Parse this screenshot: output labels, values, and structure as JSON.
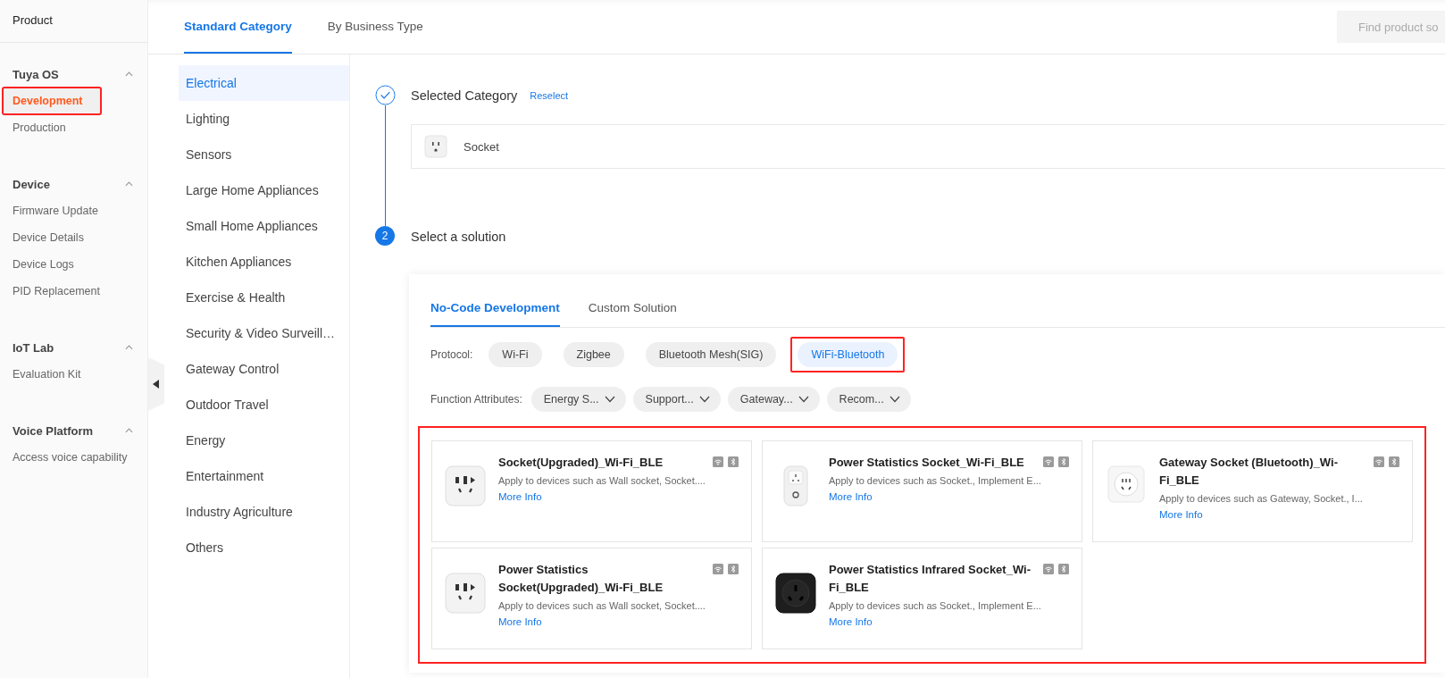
{
  "sidebar": {
    "title": "Product",
    "groups": [
      {
        "label": "Tuya OS",
        "expanded": true,
        "items": [
          {
            "label": "Development",
            "selected": true,
            "highlighted": true
          },
          {
            "label": "Production",
            "selected": false,
            "highlighted": false
          }
        ]
      },
      {
        "label": "Device",
        "expanded": true,
        "items": [
          {
            "label": "Firmware Update",
            "selected": false,
            "highlighted": false
          },
          {
            "label": "Device Details",
            "selected": false,
            "highlighted": false
          },
          {
            "label": "Device Logs",
            "selected": false,
            "highlighted": false
          },
          {
            "label": "PID Replacement",
            "selected": false,
            "highlighted": false
          }
        ]
      },
      {
        "label": "IoT Lab",
        "expanded": true,
        "items": [
          {
            "label": "Evaluation Kit",
            "selected": false,
            "highlighted": false
          }
        ]
      },
      {
        "label": "Voice Platform",
        "expanded": true,
        "items": [
          {
            "label": "Access voice capability",
            "selected": false,
            "highlighted": false
          }
        ]
      }
    ]
  },
  "top_tabs": [
    {
      "label": "Standard Category",
      "selected": true
    },
    {
      "label": "By Business Type",
      "selected": false
    }
  ],
  "search": {
    "placeholder": "Find product so"
  },
  "categories": [
    {
      "label": "Electrical",
      "selected": true
    },
    {
      "label": "Lighting",
      "selected": false
    },
    {
      "label": "Sensors",
      "selected": false
    },
    {
      "label": "Large Home Appliances",
      "selected": false
    },
    {
      "label": "Small Home Appliances",
      "selected": false
    },
    {
      "label": "Kitchen Appliances",
      "selected": false
    },
    {
      "label": "Exercise & Health",
      "selected": false
    },
    {
      "label": "Security & Video Surveill…",
      "selected": false
    },
    {
      "label": "Gateway Control",
      "selected": false
    },
    {
      "label": "Outdoor Travel",
      "selected": false
    },
    {
      "label": "Energy",
      "selected": false
    },
    {
      "label": "Entertainment",
      "selected": false
    },
    {
      "label": "Industry Agriculture",
      "selected": false
    },
    {
      "label": "Others",
      "selected": false
    }
  ],
  "steps": [
    {
      "kind": "done",
      "title": "Selected Category",
      "link": "Reselect"
    },
    {
      "kind": "current",
      "title": "Select a solution",
      "number": "2"
    }
  ],
  "selected_category": {
    "label": "Socket"
  },
  "solution_tabs": [
    {
      "label": "No-Code Development",
      "selected": true
    },
    {
      "label": "Custom Solution",
      "selected": false
    }
  ],
  "protocol": {
    "label": "Protocol:",
    "options": [
      {
        "label": "Wi-Fi",
        "selected": false,
        "highlighted": false
      },
      {
        "label": "Zigbee",
        "selected": false,
        "highlighted": false
      },
      {
        "label": "Bluetooth Mesh(SIG)",
        "selected": false,
        "highlighted": false
      },
      {
        "label": "WiFi-Bluetooth",
        "selected": true,
        "highlighted": true
      }
    ]
  },
  "function_attributes": {
    "label": "Function Attributes:",
    "options": [
      "Energy S...",
      "Support...",
      "Gateway...",
      "Recom..."
    ]
  },
  "cards_highlighted": true,
  "cards": [
    {
      "kind": "white-square",
      "title": "Socket(Upgraded)_Wi-Fi_BLE",
      "description": "Apply to devices such as Wall socket,  Socket....",
      "link": "More Info"
    },
    {
      "kind": "white-pill",
      "title": "Power Statistics Socket_Wi-Fi_BLE",
      "description": "Apply to devices such as Socket.,  Implement E...",
      "link": "More Info"
    },
    {
      "kind": "white-round",
      "title": "Gateway Socket (Bluetooth)_Wi-Fi_BLE",
      "description": "Apply to devices such as Gateway,  Socket.,  I...",
      "link": "More Info"
    },
    {
      "kind": "white-square",
      "title": "Power Statistics Socket(Upgraded)_Wi-Fi_BLE",
      "description": "Apply to devices such as Wall socket,  Socket....",
      "link": "More Info"
    },
    {
      "kind": "black-square",
      "title": "Power Statistics Infrared Socket_Wi-Fi_BLE",
      "description": "Apply to devices such as Socket.,  Implement E...",
      "link": "More Info"
    }
  ]
}
